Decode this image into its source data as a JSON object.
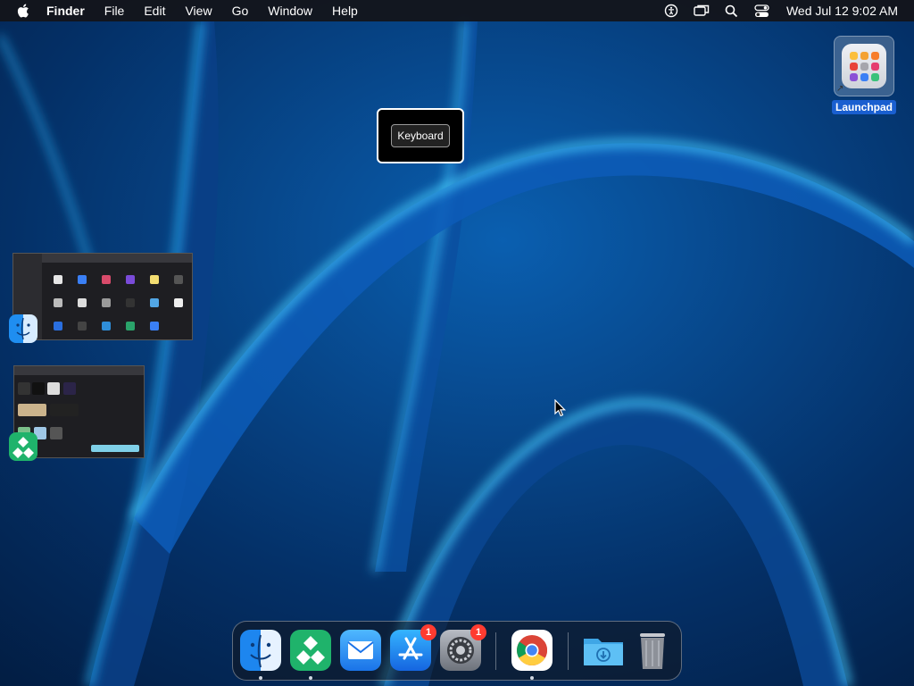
{
  "menubar": {
    "app_name": "Finder",
    "items": [
      "File",
      "Edit",
      "View",
      "Go",
      "Window",
      "Help"
    ],
    "clock": "Wed Jul 12  9:02 AM"
  },
  "desktop": {
    "launchpad_label": "Launchpad"
  },
  "tooltip": {
    "label": "Keyboard"
  },
  "dock": {
    "app_store_badge": "1",
    "settings_badge": "1"
  },
  "colors": {
    "selection_blue": "#1a5fd0",
    "badge_red": "#ff3b30",
    "wallpaper_deep": "#03204a",
    "wallpaper_glow": "#1aa8ff"
  },
  "icons": [
    "apple-icon",
    "accessibility-icon",
    "screen-mirroring-icon",
    "spotlight-icon",
    "control-center-icon",
    "launchpad-icon",
    "finder-icon",
    "codeloop-icon",
    "mail-icon",
    "app-store-icon",
    "system-settings-icon",
    "chrome-icon",
    "downloads-folder-icon",
    "trash-icon"
  ]
}
